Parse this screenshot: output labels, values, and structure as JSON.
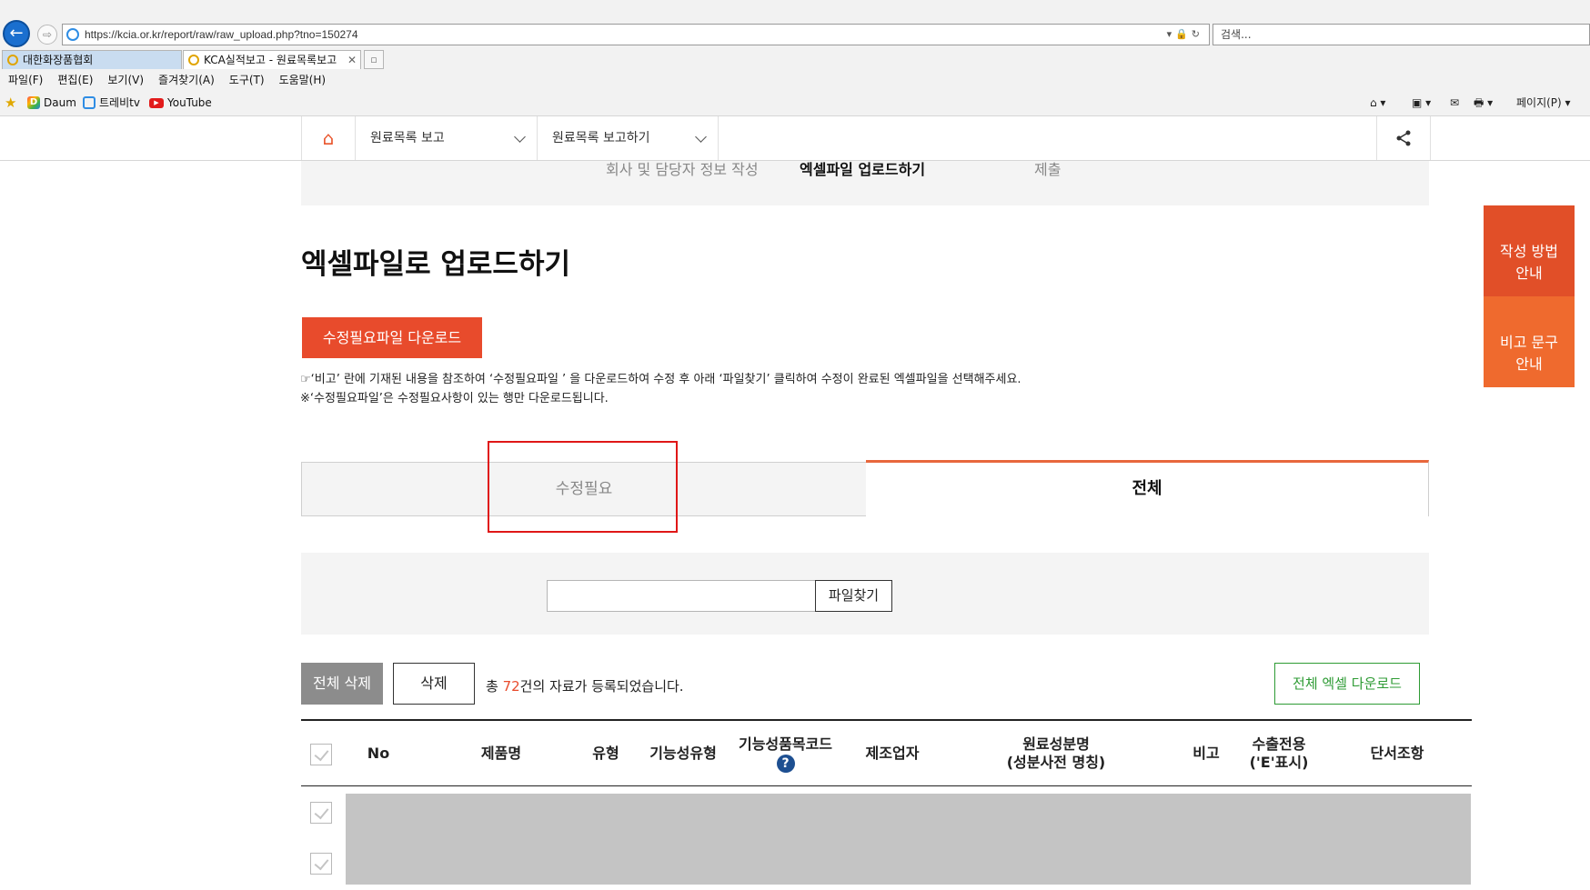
{
  "browser": {
    "url": "https://kcia.or.kr/report/raw/raw_upload.php?tno=150274",
    "search_placeholder": "검색...",
    "tabs": [
      {
        "label": "대한화장품협회"
      },
      {
        "label": "KCA실적보고 - 원료목록보고"
      }
    ],
    "menu": [
      "파일(F)",
      "편집(E)",
      "보기(V)",
      "즐겨찾기(A)",
      "도구(T)",
      "도움말(H)"
    ],
    "favorites": [
      "Daum",
      "트레비tv",
      "YouTube"
    ],
    "page_menu": "페이지(P) ▾"
  },
  "nav": {
    "dropdown1": "원료목록 보고",
    "dropdown2": "원료목록 보고하기"
  },
  "steps": [
    "회사 및 담당자 정보 작성",
    "엑셀파일 업로드하기",
    "제출"
  ],
  "main": {
    "title": "엑셀파일로 업로드하기",
    "download_fix_button": "수정필요파일 다운로드",
    "notice_line1": "☞‘비고’ 란에 기재된 내용을 참조하여 ‘수정필요파일 ’ 을 다운로드하여 수정 후 아래 ‘파일찾기’ 클릭하여 수정이 완료된 엑셀파일을 선택해주세요.",
    "notice_line2": "※‘수정필요파일’은 수정필요사항이 있는 행만 다운로드됩니다.",
    "tabs": {
      "needed": "수정필요",
      "all": "전체"
    },
    "file_button": "파일찾기",
    "delete_all_button": "전체 삭제",
    "delete_button": "삭제",
    "count_prefix": "총 ",
    "count": "72",
    "count_suffix": "건의 자료가 등록되었습니다.",
    "excel_download_button": "전체 엑셀 다운로드"
  },
  "table": {
    "columns": {
      "no": "No",
      "product": "제품명",
      "type": "유형",
      "func_type": "기능성유형",
      "func_code": "기능성품목코드",
      "maker": "제조업자",
      "ingredient_1": "원료성분명",
      "ingredient_2": "(성분사전 명칭)",
      "remark": "비고",
      "export_1": "수출전용",
      "export_2": "('E'표시)",
      "clause": "단서조항"
    }
  },
  "side": {
    "guide": "작성 방법\n안내",
    "remark_guide": "비고 문구\n안내"
  },
  "colors": {
    "accent": "#e84b2c",
    "tab_active_border": "#e8673c",
    "excel_green": "#2e9b34",
    "highlight_red": "#e01717"
  }
}
